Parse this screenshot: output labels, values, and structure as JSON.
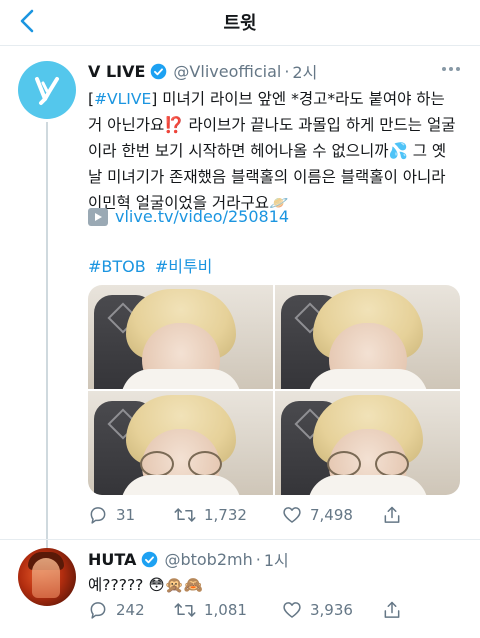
{
  "header": {
    "title": "트윗"
  },
  "tweet": {
    "name": "V LIVE",
    "handle": "@Vliveofficial",
    "separator": "·",
    "time": "2시",
    "lines": [
      {
        "hashtag": "#VLIVE",
        "rest": " 미녀기 라이브 앞엔 *경고*라도 붙여야 하는"
      },
      {
        "text": "거 아닌가요⁉️ 라이브가 끝나도 과몰입 하게 만드는 얼굴"
      },
      {
        "text": "이라 한번 보기 시작하면 헤어나올 수 없으니까💦 그 옛"
      },
      {
        "text": "날 미녀기가 존재했음 블랙홀의 이름은 블랙홀이 아니라"
      },
      {
        "text": "이민혁 얼굴이었을 거라구요🪐"
      }
    ],
    "link": "vlive.tv/video/250814",
    "hashtags": [
      "#BTOB",
      "#비투비"
    ],
    "stats": {
      "replies": "31",
      "retweets": "1,732",
      "likes": "7,498"
    }
  },
  "reply": {
    "name": "HUTA",
    "handle": "@btob2mh",
    "separator": "·",
    "time": "1시",
    "text": "예????? 😳🙊🙈",
    "stats": {
      "replies": "242",
      "retweets": "1,081",
      "likes": "3,936"
    }
  },
  "colors": {
    "accent": "#1b95e0",
    "muted": "#657786",
    "avatar_vlive": "#54c7ec"
  }
}
